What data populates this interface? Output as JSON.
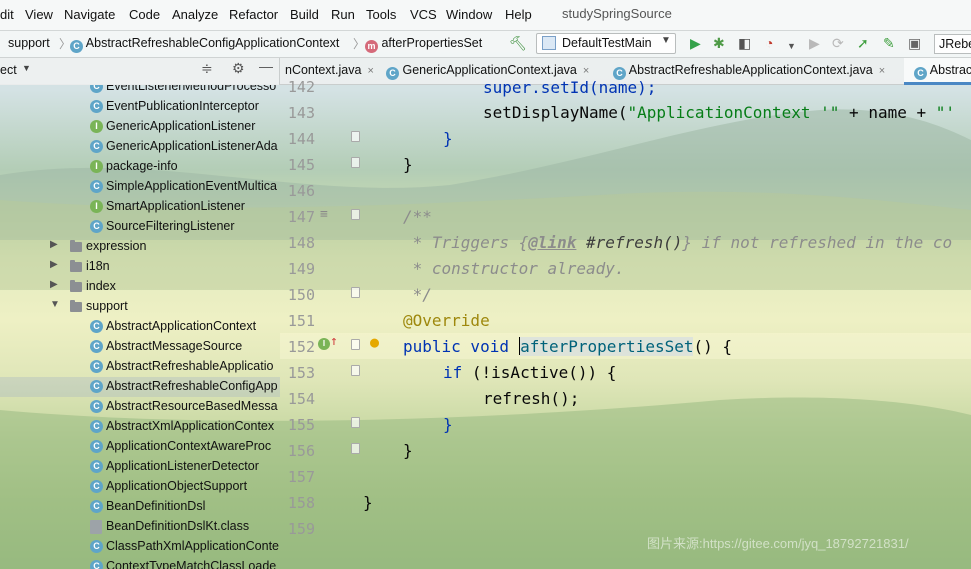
{
  "menu": {
    "items": [
      "dit",
      "View",
      "Navigate",
      "Code",
      "Analyze",
      "Refactor",
      "Build",
      "Run",
      "Tools",
      "VCS",
      "Window",
      "Help"
    ],
    "project_title": "studySpringSource"
  },
  "navbar": {
    "crumb1": "support",
    "crumb2": "AbstractRefreshableConfigApplicationContext",
    "crumb3": "afterPropertiesSet",
    "run_config": "DefaultTestMain",
    "jrebel": "JRebe"
  },
  "tabs": {
    "items": [
      "nContext.java",
      "GenericApplicationContext.java",
      "AbstractRefreshableApplicationContext.java",
      "Abstrac"
    ],
    "close_glyph": "×"
  },
  "project_panel": {
    "title": "ect"
  },
  "tree": {
    "items": [
      {
        "label": "EventListenerMethodProcesso",
        "kind": "class"
      },
      {
        "label": "EventPublicationInterceptor",
        "kind": "class"
      },
      {
        "label": "GenericApplicationListener",
        "kind": "interface"
      },
      {
        "label": "GenericApplicationListenerAda",
        "kind": "class"
      },
      {
        "label": "package-info",
        "kind": "interface"
      },
      {
        "label": "SimpleApplicationEventMultica",
        "kind": "class"
      },
      {
        "label": "SmartApplicationListener",
        "kind": "interface"
      },
      {
        "label": "SourceFilteringListener",
        "kind": "class"
      },
      {
        "label": "expression",
        "kind": "folder"
      },
      {
        "label": "i18n",
        "kind": "folder"
      },
      {
        "label": "index",
        "kind": "folder"
      },
      {
        "label": "support",
        "kind": "folder-open"
      },
      {
        "label": "AbstractApplicationContext",
        "kind": "class"
      },
      {
        "label": "AbstractMessageSource",
        "kind": "class"
      },
      {
        "label": "AbstractRefreshableApplicatio",
        "kind": "class"
      },
      {
        "label": "AbstractRefreshableConfigApp",
        "kind": "class",
        "selected": true
      },
      {
        "label": "AbstractResourceBasedMessa",
        "kind": "class"
      },
      {
        "label": "AbstractXmlApplicationContex",
        "kind": "class"
      },
      {
        "label": "ApplicationContextAwareProc",
        "kind": "class"
      },
      {
        "label": "ApplicationListenerDetector",
        "kind": "class"
      },
      {
        "label": "ApplicationObjectSupport",
        "kind": "class"
      },
      {
        "label": "BeanDefinitionDsl",
        "kind": "class"
      },
      {
        "label": "BeanDefinitionDslKt.class",
        "kind": "file"
      },
      {
        "label": "ClassPathXmlApplicationConte",
        "kind": "class"
      },
      {
        "label": "ContextTypeMatchClassLoade",
        "kind": "class"
      }
    ],
    "class_glyph": "C",
    "interface_glyph": "I"
  },
  "editor": {
    "line_numbers": [
      "142",
      "143",
      "144",
      "145",
      "146",
      "147",
      "148",
      "149",
      "150",
      "151",
      "152",
      "153",
      "154",
      "155",
      "156",
      "157",
      "158",
      "159"
    ],
    "lines": {
      "l142": "super.setId(name);",
      "l143a": "setDisplayName(",
      "l143b": "\"ApplicationContext '\"",
      "l143c": " + name + ",
      "l143d": "\"'",
      "l144": "}",
      "l145": "}",
      "l147": "/**",
      "l148a": " * Triggers {",
      "l148b": "@link",
      "l148c": " #refresh()",
      "l148d": "} if not refreshed in the co",
      "l149": " * constructor already.",
      "l150": " */",
      "l151": "@Override",
      "l152a": "public void ",
      "l152b": "afterPropertiesSet",
      "l152c": "() {",
      "l153a": "if",
      "l153b": " (!isActive()) {",
      "l154": "refresh();",
      "l155": "}",
      "l156": "}",
      "l158": "}"
    }
  },
  "watermark": "图片来源:https://gitee.com/jyq_18792721831/"
}
